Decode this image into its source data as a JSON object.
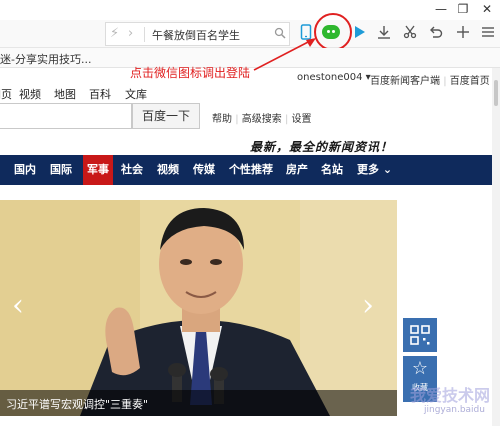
{
  "window": {
    "minimize_label": "—",
    "restore_label": "❐",
    "close_label": "✕"
  },
  "toolbar": {
    "address_text": "午餐放倒百名学生",
    "icons": [
      "lightning-icon",
      "chevron-right-icon",
      "search-icon",
      "phone-icon",
      "wechat-icon",
      "play-icon",
      "download-icon",
      "scissors-icon",
      "undo-icon",
      "plus-icon",
      "menu-icon"
    ]
  },
  "bookmarks": {
    "item_label": "迷-分享实用技巧..."
  },
  "annotation": {
    "text": "点击微信图标调出登陆",
    "color": "#e02020"
  },
  "user": {
    "name": "onestone004",
    "client_link": "百度新闻客户端",
    "home_link": "百度首页"
  },
  "nav_tabs": [
    "网页",
    "视频",
    "地图",
    "百科",
    "文库"
  ],
  "search": {
    "button_label": "百度一下",
    "help": "帮助",
    "advanced": "高级搜索",
    "settings": "设置"
  },
  "slogan": "最新，最全的新闻资讯！",
  "news_nav": {
    "items": [
      "国内",
      "国际",
      "军事",
      "社会",
      "视频",
      "传媒",
      "个性推荐",
      "房产",
      "名站",
      "更多"
    ],
    "active": "军事",
    "bg_color": "#0f2a5c",
    "active_color": "#c81818"
  },
  "hero": {
    "caption": "习近平谱写宏观调控\"三重奏\""
  },
  "side_widgets": {
    "qr_icon": "qr-code-icon",
    "star_icon": "star-icon",
    "star_label": "收藏"
  },
  "watermark": {
    "text": "我爱技术网",
    "url": "jingyan.baidu"
  }
}
